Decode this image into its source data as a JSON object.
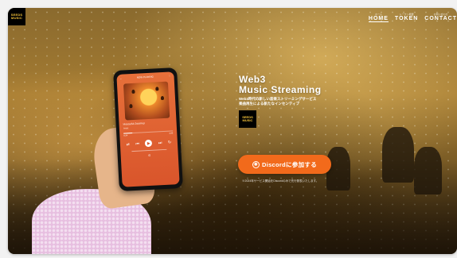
{
  "logo": {
    "line1": "SEEDS",
    "line2": "MUSIC"
  },
  "nav": [
    {
      "sub": "ホーム",
      "label": "HOME",
      "active": true
    },
    {
      "sub": "トークン概要",
      "label": "TOKEN",
      "active": false
    },
    {
      "sub": "お問い合わせ",
      "label": "CONTACT",
      "active": false
    }
  ],
  "hero": {
    "title_line1": "Web3",
    "title_line2": "Music Streaming",
    "subtitle_line1": "Web3時代の新しい音楽ストリーミングサービス",
    "subtitle_line2": "楽曲再生による新たなインセンティブ"
  },
  "token_logo": {
    "line1": "SEEDS",
    "line2": "MUSIC"
  },
  "cta": {
    "label": "Discordに参加する",
    "icon": "discord-icon"
  },
  "note": "※2024年サービス開始をDiscordのみで先行発表いたします。",
  "phone": {
    "header": "NOW PLAYING",
    "track_title": "Houseful Journey",
    "track_artist": "Artist",
    "time_elapsed": "0:24",
    "time_total": "3:45",
    "progress": 0.18
  },
  "colors": {
    "accent": "#f26a1b",
    "logo_bg": "#000000",
    "logo_text": "#f6c33a"
  }
}
